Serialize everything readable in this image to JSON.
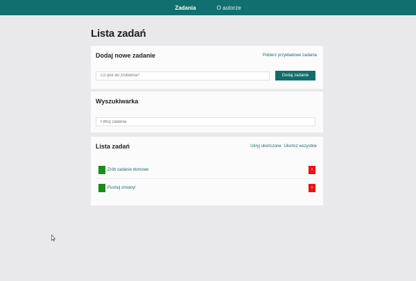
{
  "nav": {
    "items": [
      {
        "label": "Zadania",
        "active": true
      },
      {
        "label": "O autorze",
        "active": false
      }
    ]
  },
  "page": {
    "title": "Lista zadań"
  },
  "add_card": {
    "title": "Dodaj nowe zadanie",
    "sample_link": "Pobierz przykładowe zadania",
    "input_placeholder": "Co jest do zrobienia?",
    "button_label": "Dodaj zadanie"
  },
  "search_card": {
    "title": "Wyszukiwarka",
    "input_placeholder": "Filtruj zadania"
  },
  "list_card": {
    "title": "Lista zadań",
    "hide_done_link": "Ukryj ukończone",
    "complete_all_link": "Ukończ wszystkie",
    "tasks": [
      {
        "label": "Zrób zadanie domowe",
        "delete_symbol": "×"
      },
      {
        "label": "Pushuj zmiany!",
        "delete_symbol": "×"
      }
    ]
  },
  "colors": {
    "navbar": "#11706f",
    "accent": "#126d6a",
    "check": "#1a8c1a",
    "delete": "#ee1111",
    "background": "#e9e9eb"
  }
}
